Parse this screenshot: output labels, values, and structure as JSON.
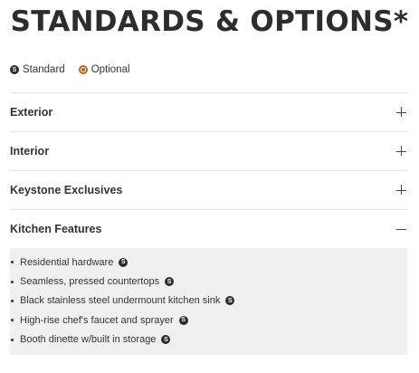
{
  "title": "STANDARDS & OPTIONS*",
  "legend": {
    "standard_label": "Standard",
    "optional_label": "Optional",
    "standard_icon": "S",
    "standard_color": "#2b2b2b",
    "optional_color": "#b5651d"
  },
  "sections": [
    {
      "label": "Exterior",
      "expanded": false
    },
    {
      "label": "Interior",
      "expanded": false
    },
    {
      "label": "Keystone Exclusives",
      "expanded": false
    },
    {
      "label": "Kitchen Features",
      "expanded": true
    }
  ],
  "kitchen_features": [
    {
      "text": "Residential hardware",
      "badge": "S"
    },
    {
      "text": "Seamless, pressed countertops",
      "badge": "S"
    },
    {
      "text": "Black stainless steel undermount kitchen sink",
      "badge": "S"
    },
    {
      "text": "High-rise chef's faucet and sprayer",
      "badge": "S"
    },
    {
      "text": "Booth dinette w/built in storage",
      "badge": "S"
    }
  ]
}
